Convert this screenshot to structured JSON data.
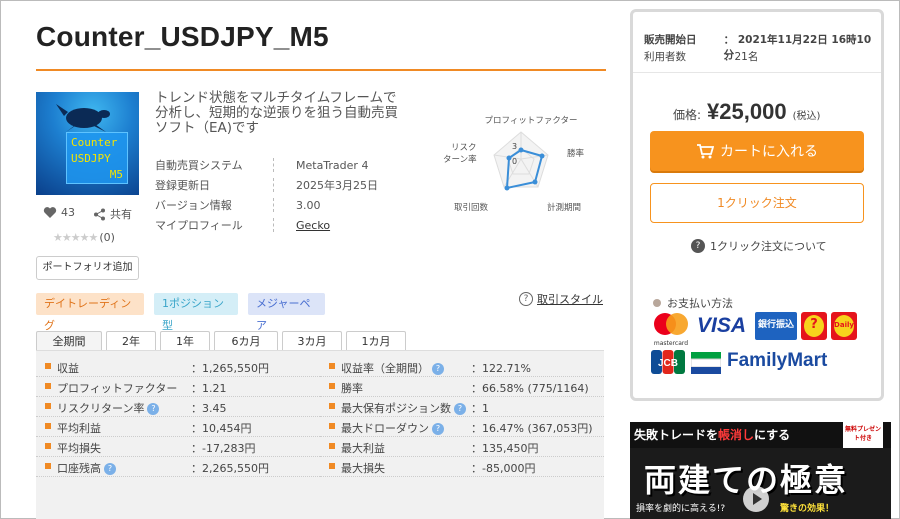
{
  "product": {
    "title": "Counter_USDJPY_M5",
    "thumb_lines": [
      "Counter",
      "USDJPY",
      "M5"
    ],
    "likes": "43",
    "share_label": "共有",
    "stars": "★★★★★",
    "review_count": "(0)",
    "portfolio_label": "ポートフォリオ追加",
    "description": "トレンド状態をマルチタイムフレームで分析し、短期的な逆張りを狙う自動売買ソフト（EA)です",
    "specs": [
      {
        "key": "自動売買システム",
        "value": "MetaTrader 4"
      },
      {
        "key": "登録更新日",
        "value": "2025年3月25日"
      },
      {
        "key": "バージョン情報",
        "value": "3.00"
      },
      {
        "key": "マイプロフィール",
        "value": "Gecko"
      }
    ]
  },
  "radar": {
    "labels": {
      "top": "プロフィットファクター",
      "right": "勝率",
      "bottom_right": "計測期間",
      "bottom_left": "取引回数",
      "left": "リスク\nターン率"
    },
    "scale_top": "3",
    "scale_mid": "0"
  },
  "tags": [
    "デイトレーディング",
    "1ポジション型",
    "メジャーペア"
  ],
  "trade_style_label": "取引スタイル",
  "tabs": [
    "全期間",
    "2年",
    "1年",
    "6カ月",
    "3カ月",
    "1カ月"
  ],
  "stats_left": [
    {
      "key": "収益",
      "value": "：1,265,550円",
      "help": false
    },
    {
      "key": "プロフィットファクター",
      "value": "：1.21",
      "help": false
    },
    {
      "key": "リスクリターン率",
      "value": "：3.45",
      "help": true
    },
    {
      "key": "平均利益",
      "value": "：10,454円",
      "help": false
    },
    {
      "key": "平均損失",
      "value": "：-17,283円",
      "help": false
    },
    {
      "key": "口座残高",
      "value": "：2,265,550円",
      "help": true
    }
  ],
  "stats_right": [
    {
      "key": "収益率（全期間）",
      "value": "：122.71%",
      "help": true
    },
    {
      "key": "勝率",
      "value": "：66.58% (775/1164)",
      "help": false
    },
    {
      "key": "最大保有ポジション数",
      "value": "：1",
      "help": true
    },
    {
      "key": "最大ドローダウン",
      "value": "：16.47% (367,053円)",
      "help": true
    },
    {
      "key": "最大利益",
      "value": "：135,450円",
      "help": false
    },
    {
      "key": "最大損失",
      "value": "：-85,000円",
      "help": false
    }
  ],
  "sidebar": {
    "sale_start_key": "販売開始日",
    "sale_start_value": "：  2021年11月22日 16時10分",
    "users_key": "利用者数",
    "users_value": "：21名",
    "price_label": "価格:",
    "price": "¥25,000",
    "tax_label": "(税込)",
    "cart_label": "カートに入れる",
    "oneclick_label": "1クリック注文",
    "oneclick_help": "1クリック注文について",
    "payment_title": "お支払い方法",
    "mastercard": "mastercard",
    "visa": "VISA",
    "bank": "銀行振込",
    "daily": "Daily",
    "jcb": "JCB",
    "familymart": "FamilyMart"
  },
  "banner": {
    "head_pre": "失敗トレード",
    "head_mid": "を",
    "head_red": "帳消し",
    "head_post": "にする",
    "badge": "無料プレゼント付き",
    "big": "両建ての極意",
    "sub": "損率を劇的に高える!?",
    "sub2": "驚きの効果！"
  }
}
